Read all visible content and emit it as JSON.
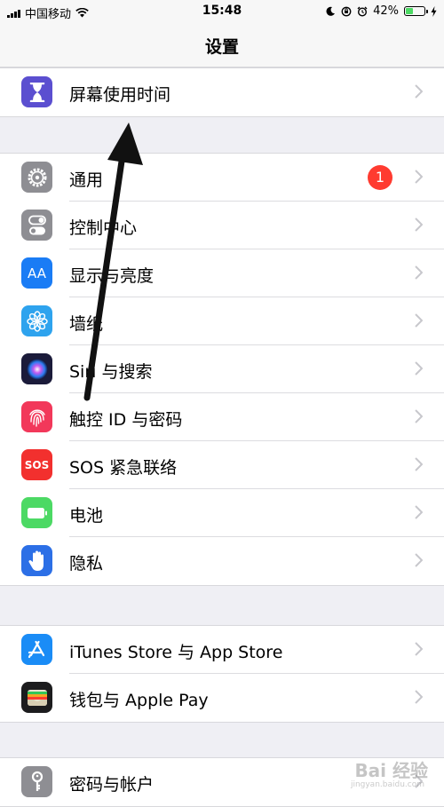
{
  "status_bar": {
    "carrier": "中国移动",
    "time": "15:48",
    "battery_percent": "42%",
    "battery_level": 0.42
  },
  "nav": {
    "title": "设置"
  },
  "groups": [
    {
      "items": [
        {
          "label": "屏幕使用时间",
          "icon": "hourglass-icon",
          "color": "#5b4fd0"
        }
      ]
    },
    {
      "items": [
        {
          "label": "通用",
          "icon": "gear-icon",
          "color": "#8e8e93",
          "badge": "1"
        },
        {
          "label": "控制中心",
          "icon": "toggle-icon",
          "color": "#8e8e93"
        },
        {
          "label": "显示与亮度",
          "icon": "text-size-icon",
          "color": "#1a7cf5",
          "icon_text": "AA"
        },
        {
          "label": "墙纸",
          "icon": "flower-icon",
          "color": "#2ea3ee"
        },
        {
          "label": "Siri 与搜索",
          "icon": "siri-icon",
          "color": "#1b1b3a"
        },
        {
          "label": "触控 ID 与密码",
          "icon": "fingerprint-icon",
          "color": "#f2385a"
        },
        {
          "label": "SOS 紧急联络",
          "icon": "sos-icon",
          "color": "#f2302e",
          "icon_text": "SOS"
        },
        {
          "label": "电池",
          "icon": "battery-icon",
          "color": "#4cd964"
        },
        {
          "label": "隐私",
          "icon": "hand-icon",
          "color": "#2c6fe6"
        }
      ]
    },
    {
      "items": [
        {
          "label": "iTunes Store 与 App Store",
          "icon": "app-store-icon",
          "color": "#1a8cf6"
        },
        {
          "label": "钱包与 Apple Pay",
          "icon": "wallet-icon",
          "color": "#1c1c1e"
        }
      ]
    },
    {
      "items": [
        {
          "label": "密码与帐户",
          "icon": "key-icon",
          "color": "#8e8e93"
        }
      ]
    }
  ],
  "watermark": {
    "text": "Bai 经验",
    "sub": "jingyan.baidu.com"
  }
}
